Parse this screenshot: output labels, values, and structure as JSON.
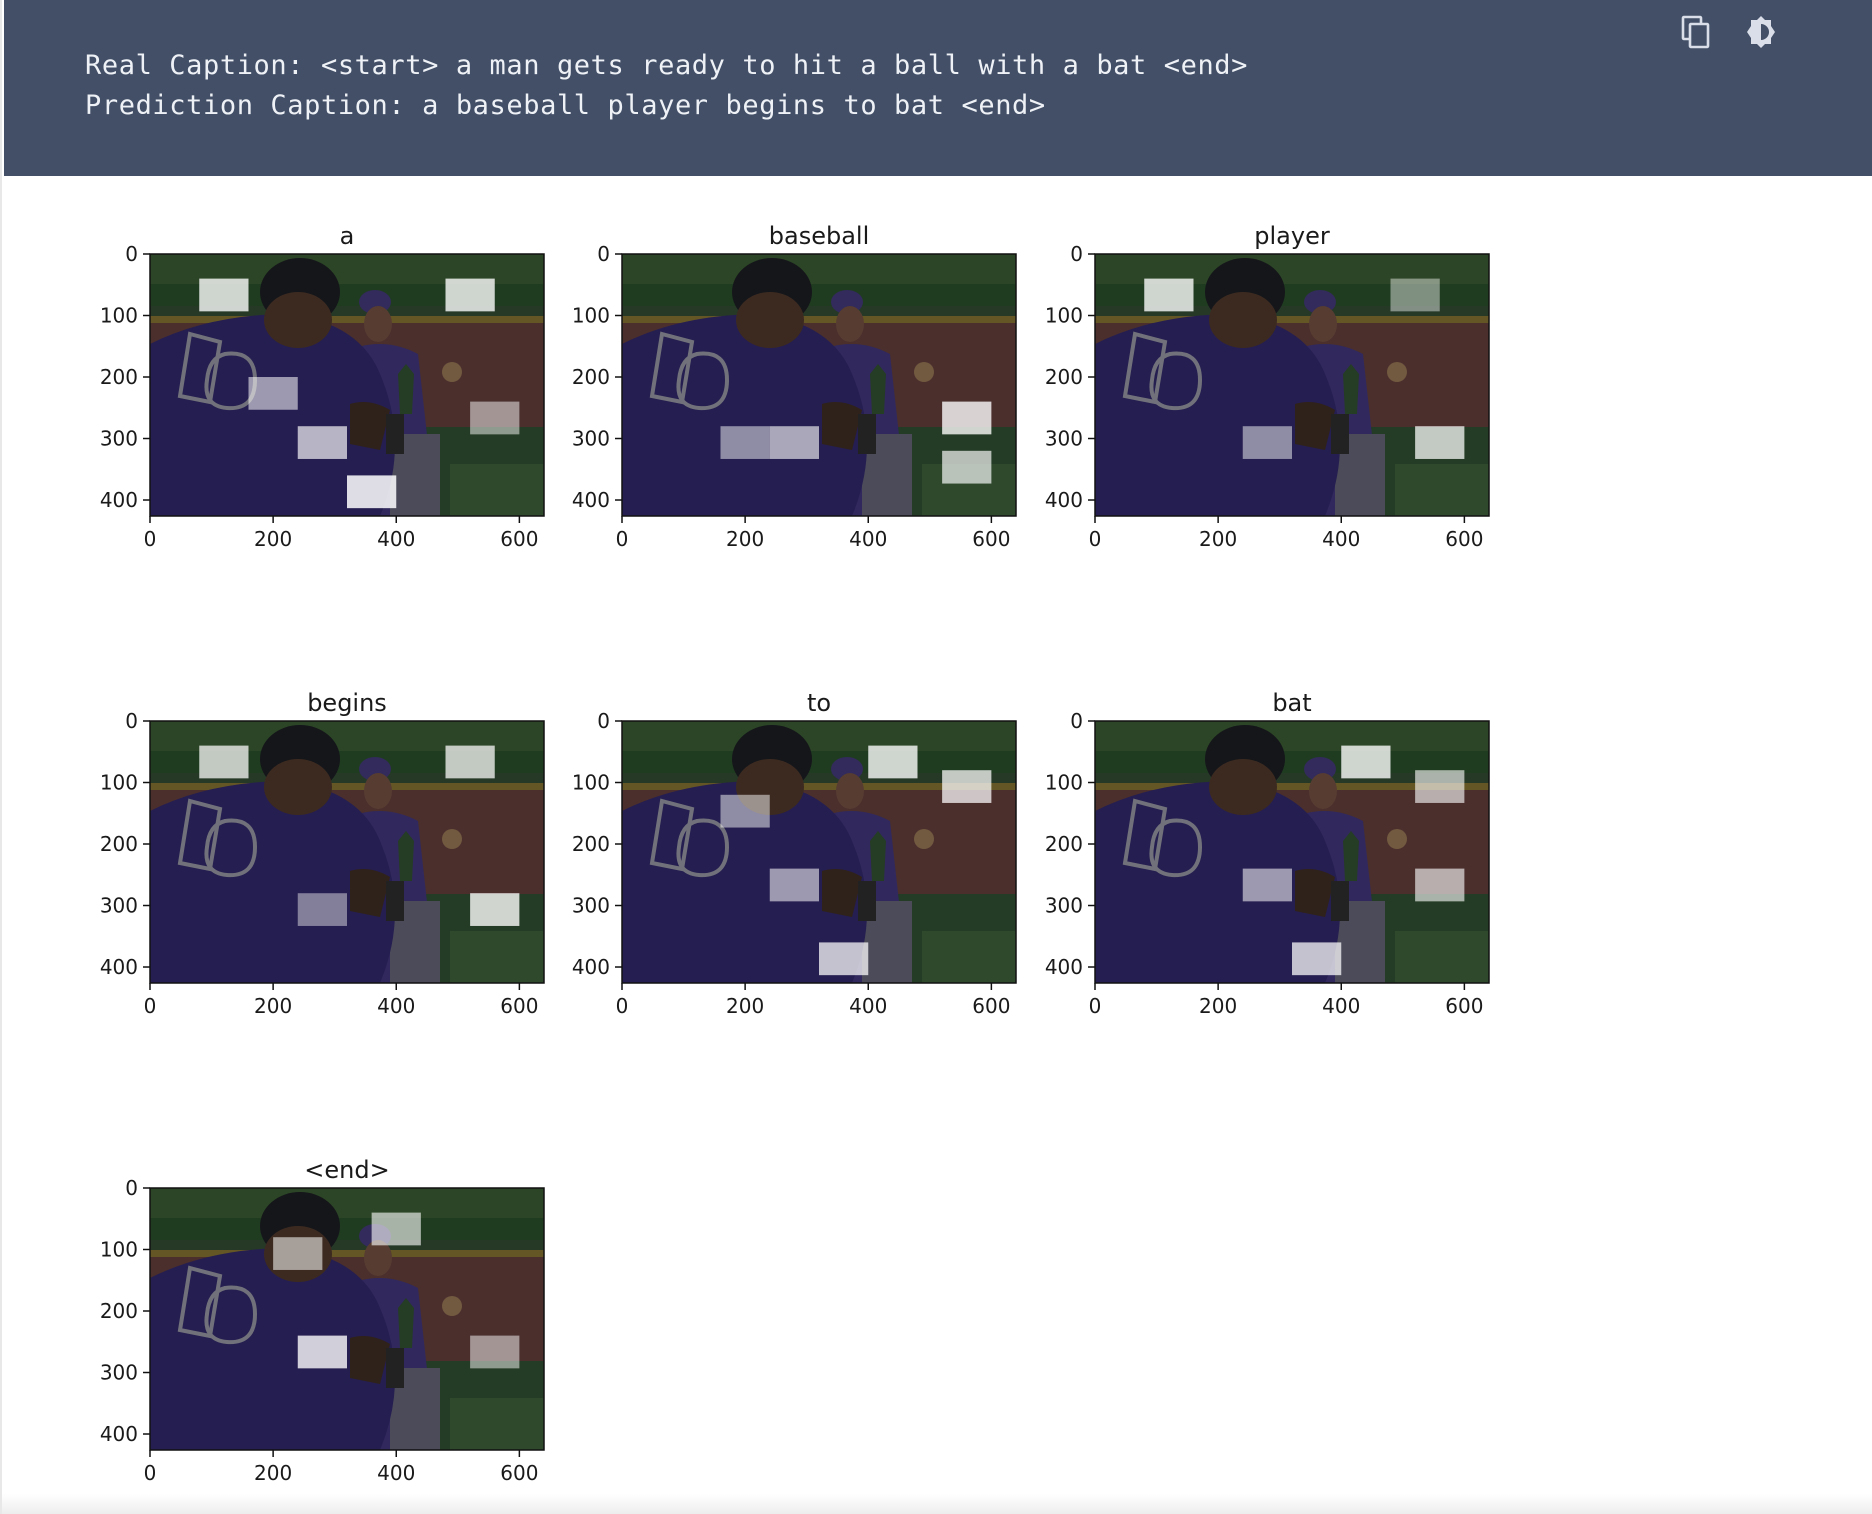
{
  "output": {
    "real_caption": "Real Caption: <start> a man gets ready to hit a ball with a bat <end>",
    "prediction_caption": "Prediction Caption: a baseball player begins to bat <end>"
  },
  "toolbar": {
    "copy_icon": "copy-icon",
    "theme_icon": "theme-toggle-icon"
  },
  "colors": {
    "header_bg": "#424f67",
    "jersey": "#3a2a66"
  },
  "chart_data": [
    {
      "type": "heatmap",
      "title": "a",
      "xticks": [
        "0",
        "200",
        "400",
        "600"
      ],
      "yticks": [
        "0",
        "100",
        "200",
        "300",
        "400"
      ],
      "xlim": [
        0,
        640
      ],
      "ylim": [
        426,
        0
      ],
      "attention": [
        [
          0.9,
          160,
          80
        ],
        [
          0.9,
          560,
          80
        ],
        [
          0.5,
          240,
          240
        ],
        [
          0.7,
          320,
          320
        ],
        [
          1.0,
          400,
          400
        ],
        [
          0.4,
          600,
          280
        ]
      ]
    },
    {
      "type": "heatmap",
      "title": "baseball",
      "xticks": [
        "0",
        "200",
        "400",
        "600"
      ],
      "yticks": [
        "0",
        "100",
        "200",
        "300",
        "400"
      ],
      "xlim": [
        0,
        640
      ],
      "ylim": [
        426,
        0
      ],
      "attention": [
        [
          0.9,
          600,
          280
        ],
        [
          0.7,
          600,
          360
        ],
        [
          0.6,
          320,
          320
        ],
        [
          0.4,
          240,
          320
        ]
      ]
    },
    {
      "type": "heatmap",
      "title": "player",
      "xticks": [
        "0",
        "200",
        "400",
        "600"
      ],
      "yticks": [
        "0",
        "100",
        "200",
        "300",
        "400"
      ],
      "xlim": [
        0,
        640
      ],
      "ylim": [
        426,
        0
      ],
      "attention": [
        [
          0.9,
          160,
          80
        ],
        [
          0.8,
          600,
          320
        ],
        [
          0.4,
          320,
          320
        ],
        [
          0.3,
          560,
          80
        ]
      ]
    },
    {
      "type": "heatmap",
      "title": "begins",
      "xticks": [
        "0",
        "200",
        "400",
        "600"
      ],
      "yticks": [
        "0",
        "100",
        "200",
        "300",
        "400"
      ],
      "xlim": [
        0,
        640
      ],
      "ylim": [
        426,
        0
      ],
      "attention": [
        [
          0.8,
          160,
          80
        ],
        [
          0.8,
          560,
          80
        ],
        [
          0.9,
          600,
          320
        ],
        [
          0.3,
          320,
          320
        ]
      ]
    },
    {
      "type": "heatmap",
      "title": "to",
      "xticks": [
        "0",
        "200",
        "400",
        "600"
      ],
      "yticks": [
        "0",
        "100",
        "200",
        "300",
        "400"
      ],
      "xlim": [
        0,
        640
      ],
      "ylim": [
        426,
        0
      ],
      "attention": [
        [
          0.9,
          480,
          80
        ],
        [
          0.8,
          400,
          400
        ],
        [
          0.8,
          600,
          120
        ],
        [
          0.5,
          320,
          280
        ],
        [
          0.4,
          240,
          160
        ]
      ]
    },
    {
      "type": "heatmap",
      "title": "bat",
      "xticks": [
        "0",
        "200",
        "400",
        "600"
      ],
      "yticks": [
        "0",
        "100",
        "200",
        "300",
        "400"
      ],
      "xlim": [
        0,
        640
      ],
      "ylim": [
        426,
        0
      ],
      "attention": [
        [
          0.9,
          480,
          80
        ],
        [
          0.8,
          400,
          400
        ],
        [
          0.6,
          600,
          120
        ],
        [
          0.5,
          320,
          280
        ],
        [
          0.6,
          600,
          280
        ]
      ]
    },
    {
      "type": "heatmap",
      "title": "<end>",
      "xticks": [
        "0",
        "200",
        "400",
        "600"
      ],
      "yticks": [
        "0",
        "100",
        "200",
        "300",
        "400"
      ],
      "xlim": [
        0,
        640
      ],
      "ylim": [
        426,
        0
      ],
      "attention": [
        [
          0.9,
          320,
          280
        ],
        [
          0.6,
          440,
          80
        ],
        [
          0.5,
          280,
          120
        ],
        [
          0.4,
          600,
          280
        ]
      ]
    }
  ]
}
